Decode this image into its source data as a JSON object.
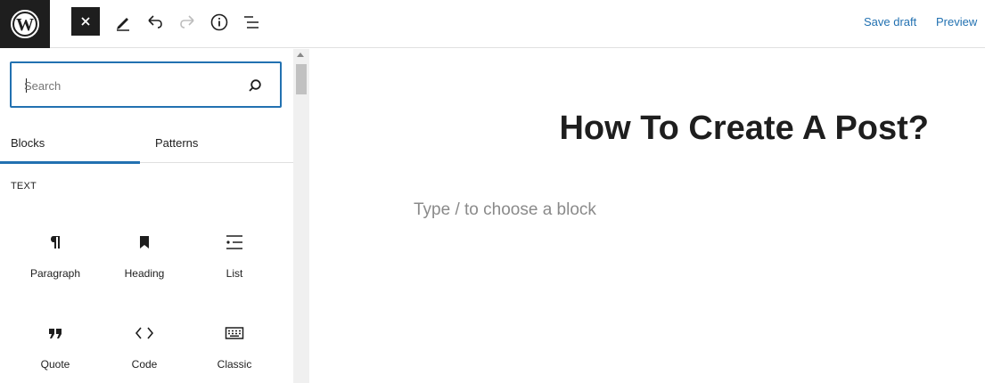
{
  "toolbar": {
    "logo_icon": "wordpress-icon",
    "close_icon": "close-icon",
    "tools_icon": "pencil-icon",
    "undo_icon": "undo-icon",
    "redo_icon": "redo-icon",
    "details_icon": "info-icon",
    "outline_icon": "list-view-icon",
    "save_draft_label": "Save draft",
    "preview_label": "Preview"
  },
  "inserter": {
    "search": {
      "placeholder": "Search",
      "value": ""
    },
    "tabs": [
      {
        "label": "Blocks",
        "active": true
      },
      {
        "label": "Patterns",
        "active": false
      }
    ],
    "category": "TEXT",
    "blocks": [
      {
        "label": "Paragraph",
        "icon": "paragraph-icon"
      },
      {
        "label": "Heading",
        "icon": "bookmark-icon"
      },
      {
        "label": "List",
        "icon": "list-icon"
      },
      {
        "label": "Quote",
        "icon": "quote-icon"
      },
      {
        "label": "Code",
        "icon": "code-icon"
      },
      {
        "label": "Classic",
        "icon": "keyboard-icon"
      }
    ]
  },
  "editor": {
    "title": "How To Create A Post?",
    "placeholder": "Type / to choose a block"
  },
  "colors": {
    "accent": "#2271b1",
    "dark": "#1e1e1e",
    "border": "#e0e0e0",
    "muted": "#757575"
  }
}
